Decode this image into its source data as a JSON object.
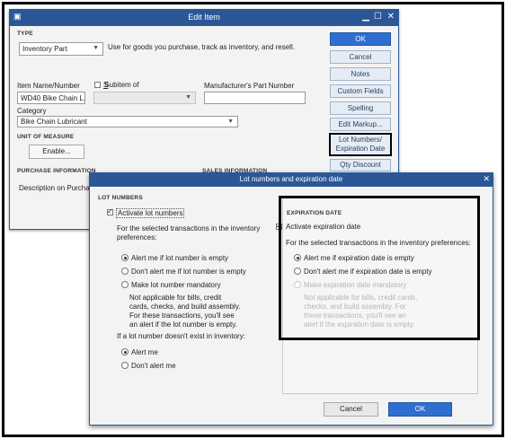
{
  "edit_item": {
    "title": "Edit Item",
    "type_label": "TYPE",
    "type_value": "Inventory Part",
    "type_desc": "Use for goods you purchase, track as inventory, and resell.",
    "item_name_label": "Item Name/Number",
    "item_name_value": "WD40 Bike Chain L...",
    "subitem_label": "Subitem of",
    "mfr_label": "Manufacturer's Part Number",
    "category_label": "Category",
    "category_value": "Bike Chain Lubricant",
    "uom_label": "UNIT OF MEASURE",
    "enable_label": "Enable...",
    "purchase_info_label": "PURCHASE INFORMATION",
    "sales_info_label": "SALES INFORMATION",
    "desc_purchase_label": "Description on Purchase"
  },
  "side_buttons": {
    "ok": "OK",
    "cancel": "Cancel",
    "notes": "Notes",
    "custom_fields": "Custom Fields",
    "spelling": "Spelling",
    "edit_markup": "Edit Markup...",
    "lot_numbers_1": "Lot Numbers/",
    "lot_numbers_2": "Expiration Date",
    "qty_discount": "Qty Discount"
  },
  "dialog": {
    "title": "Lot numbers and expiration date",
    "lot": {
      "section": "LOT NUMBERS",
      "activate": "Activate lot numbers",
      "intro": "For the selected transactions in the inventory preferences:",
      "opt_alert": "Alert me if lot number is empty",
      "opt_no_alert": "Don't alert me if lot number is empty",
      "opt_mandatory": "Make lot number mandatory",
      "note": "Not applicable for bills, credit cards, checks, and build assembly. For these transactions, you'll see an alert if the lot number is empty.",
      "not_exist": "If a lot number doesn't exist in inventory:",
      "alert_me": "Alert me",
      "dont_alert": "Don't alert me"
    },
    "exp": {
      "section": "EXPIRATION DATE",
      "activate": "Activate expiration date",
      "intro": "For the selected transactions in the inventory preferences:",
      "opt_alert": "Alert me if expiration date is empty",
      "opt_no_alert": "Don't alert me if expiration date is empty",
      "opt_mandatory": "Make expiration date mandatory",
      "note": "Not applicable for bills, credit cards, checks, and build assembly. For these transactions, you'll see an alert if the expiration date is empty."
    },
    "cancel": "Cancel",
    "ok": "OK"
  }
}
